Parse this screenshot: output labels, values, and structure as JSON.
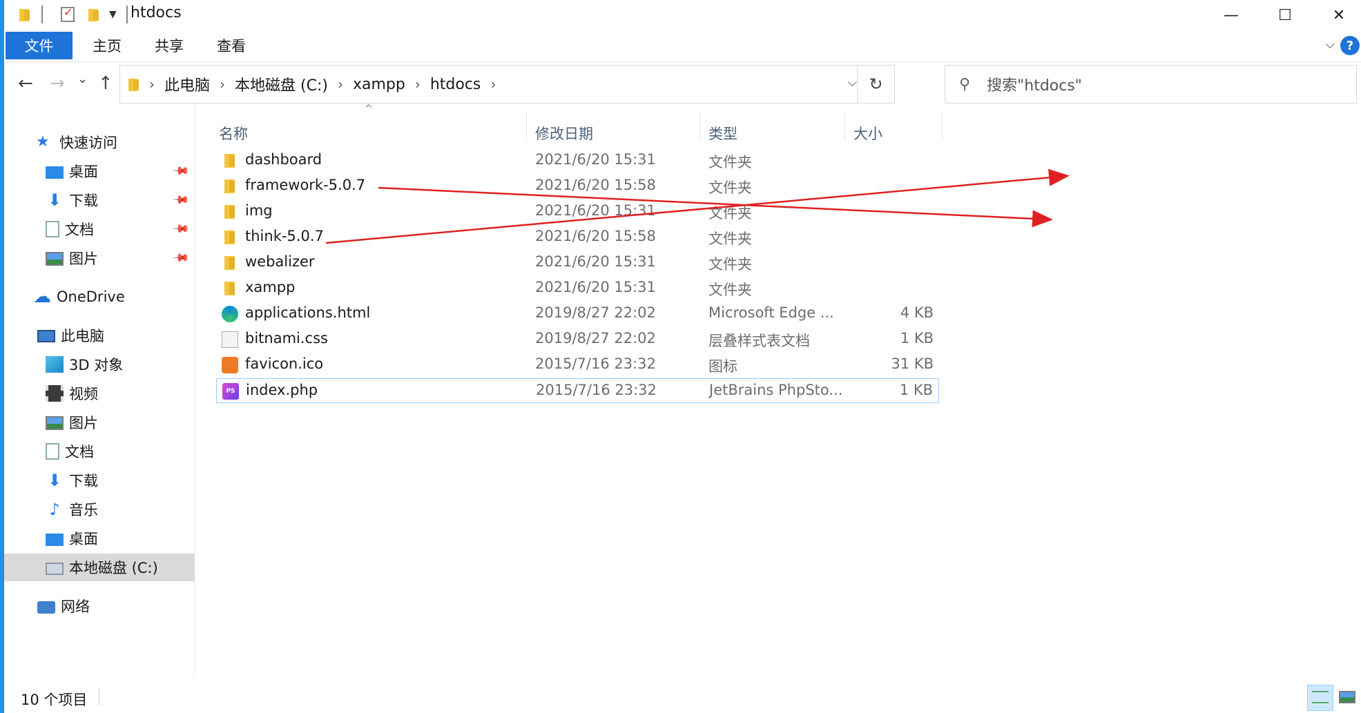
{
  "window": {
    "title": "htdocs",
    "minimize": "—",
    "maximize": "☐",
    "close": "✕"
  },
  "ribbon": {
    "tabs": [
      "文件",
      "主页",
      "共享",
      "查看"
    ],
    "help": "?"
  },
  "nav": {
    "back": "←",
    "forward": "→",
    "recent": "⌄",
    "up": "↑",
    "breadcrumbs": [
      "此电脑",
      "本地磁盘 (C:)",
      "xampp",
      "htdocs"
    ],
    "search_placeholder": "搜索\"htdocs\""
  },
  "sidebar": {
    "items": [
      {
        "label": "快速访问",
        "icon": "star-icon",
        "level": 0,
        "pinned": false
      },
      {
        "label": "桌面",
        "icon": "desktop-icon",
        "level": 1,
        "pinned": true
      },
      {
        "label": "下载",
        "icon": "download-icon",
        "level": 1,
        "pinned": true
      },
      {
        "label": "文档",
        "icon": "document-icon",
        "level": 1,
        "pinned": true
      },
      {
        "label": "图片",
        "icon": "pictures-icon",
        "level": 1,
        "pinned": true
      },
      {
        "label": "OneDrive",
        "icon": "onedrive-icon",
        "level": 0,
        "pinned": false
      },
      {
        "label": "此电脑",
        "icon": "this-pc-icon",
        "level": 0,
        "pinned": false
      },
      {
        "label": "3D 对象",
        "icon": "3d-objects-icon",
        "level": 1,
        "pinned": false
      },
      {
        "label": "视频",
        "icon": "videos-icon",
        "level": 1,
        "pinned": false
      },
      {
        "label": "图片",
        "icon": "pictures-icon",
        "level": 1,
        "pinned": false
      },
      {
        "label": "文档",
        "icon": "document-icon",
        "level": 1,
        "pinned": false
      },
      {
        "label": "下载",
        "icon": "download-icon",
        "level": 1,
        "pinned": false
      },
      {
        "label": "音乐",
        "icon": "music-icon",
        "level": 1,
        "pinned": false
      },
      {
        "label": "桌面",
        "icon": "desktop-icon",
        "level": 1,
        "pinned": false
      },
      {
        "label": "本地磁盘 (C:)",
        "icon": "local-disk-icon",
        "level": 1,
        "pinned": false,
        "selected": true
      },
      {
        "label": "网络",
        "icon": "network-icon",
        "level": 0,
        "pinned": false
      }
    ]
  },
  "columns": {
    "name": "名称",
    "date": "修改日期",
    "type": "类型",
    "size": "大小"
  },
  "files": [
    {
      "name": "dashboard",
      "date": "2021/6/20 15:31",
      "type": "文件夹",
      "size": "",
      "icon": "folder-icon"
    },
    {
      "name": "framework-5.0.7",
      "date": "2021/6/20 15:58",
      "type": "文件夹",
      "size": "",
      "icon": "folder-icon"
    },
    {
      "name": "img",
      "date": "2021/6/20 15:31",
      "type": "文件夹",
      "size": "",
      "icon": "folder-icon"
    },
    {
      "name": "think-5.0.7",
      "date": "2021/6/20 15:58",
      "type": "文件夹",
      "size": "",
      "icon": "folder-icon"
    },
    {
      "name": "webalizer",
      "date": "2021/6/20 15:31",
      "type": "文件夹",
      "size": "",
      "icon": "folder-icon"
    },
    {
      "name": "xampp",
      "date": "2021/6/20 15:31",
      "type": "文件夹",
      "size": "",
      "icon": "folder-icon"
    },
    {
      "name": "applications.html",
      "date": "2019/8/27 22:02",
      "type": "Microsoft Edge ...",
      "size": "4 KB",
      "icon": "edge-html-icon"
    },
    {
      "name": "bitnami.css",
      "date": "2019/8/27 22:02",
      "type": "层叠样式表文档",
      "size": "1 KB",
      "icon": "css-file-icon"
    },
    {
      "name": "favicon.ico",
      "date": "2015/7/16 23:32",
      "type": "图标",
      "size": "31 KB",
      "icon": "xampp-ico-icon"
    },
    {
      "name": "index.php",
      "date": "2015/7/16 23:32",
      "type": "JetBrains PhpSto...",
      "size": "1 KB",
      "icon": "phpstorm-file-icon",
      "highlighted": true
    }
  ],
  "status": {
    "count": "10 个项目"
  },
  "colors": {
    "accent": "#1e73d8",
    "annotation_arrow": "#e02020"
  }
}
